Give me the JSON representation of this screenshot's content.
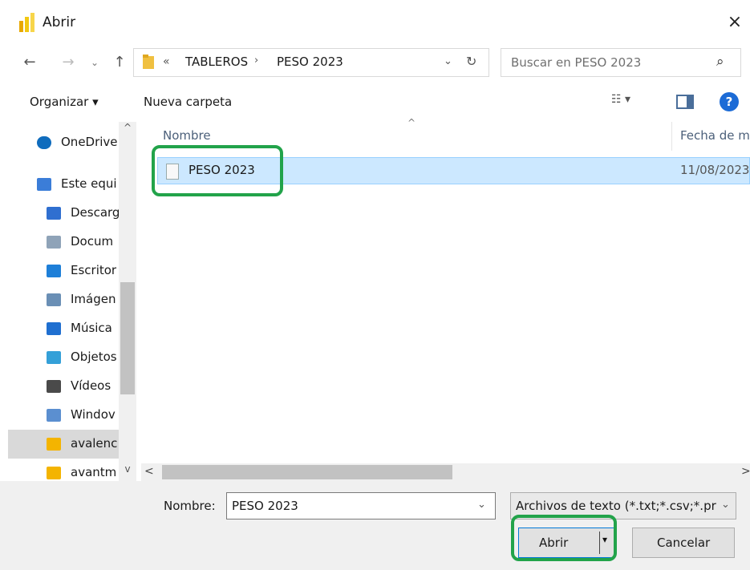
{
  "window": {
    "title": "Abrir",
    "close_icon": "×"
  },
  "navigation": {
    "back_icon": "←",
    "forward_icon": "→",
    "recent_icon": "⌄",
    "up_icon": "↑",
    "breadcrumb_overflow": "«",
    "path": [
      "TABLEROS",
      "PESO 2023"
    ],
    "path_separator": "›",
    "dropdown_icon": "⌄",
    "refresh_icon": "↻"
  },
  "search": {
    "placeholder": "Buscar en PESO 2023",
    "icon": "⌕"
  },
  "toolbar": {
    "organize_label": "Organizar ▾",
    "new_folder_label": "Nueva carpeta",
    "view_label": "☷ ▾",
    "help_label": "?"
  },
  "sidebar": {
    "items": [
      {
        "label": "OneDrive",
        "icon": "cloud-icon",
        "color": "#0f6cbd"
      },
      {
        "label": "Este equi",
        "icon": "computer-icon",
        "color": "#3b7dd8"
      },
      {
        "label": "Descarg",
        "icon": "download-icon",
        "color": "#2f6fd0"
      },
      {
        "label": "Docum",
        "icon": "document-icon",
        "color": "#8fa3b8"
      },
      {
        "label": "Escritor",
        "icon": "desktop-icon",
        "color": "#1e7fd8"
      },
      {
        "label": "Imágen",
        "icon": "image-icon",
        "color": "#6a8fb5"
      },
      {
        "label": "Música",
        "icon": "music-icon",
        "color": "#1f6fd0"
      },
      {
        "label": "Objetos",
        "icon": "3d-objects-icon",
        "color": "#34a0d8"
      },
      {
        "label": "Vídeos",
        "icon": "video-icon",
        "color": "#4a4a4a"
      },
      {
        "label": "Windov",
        "icon": "drive-icon",
        "color": "#5b8fd0"
      },
      {
        "label": "avalenc",
        "icon": "google-drive-icon",
        "color": "#f4b400"
      },
      {
        "label": "avantm",
        "icon": "google-drive-icon",
        "color": "#f4b400"
      }
    ],
    "selected_index": 10,
    "scroll_up_icon": "^",
    "scroll_down_icon": "v"
  },
  "file_list": {
    "columns": [
      "Nombre",
      "Fecha de m"
    ],
    "sort_icon": "^",
    "rows": [
      {
        "name": "PESO 2023",
        "date": "11/08/2023"
      }
    ]
  },
  "hscroll": {
    "left_icon": "<",
    "right_icon": ">"
  },
  "footer": {
    "filename_label": "Nombre:",
    "filename_value": "PESO 2023",
    "filename_dropdown": "⌄",
    "filter_value": "Archivos de texto (*.txt;*.csv;*.prn)",
    "filter_dropdown": "⌄",
    "open_label": "Abrir",
    "open_arrow": "▾",
    "cancel_label": "Cancelar"
  },
  "colors": {
    "highlight": "#22a34a",
    "selection": "#cce8ff",
    "accent": "#0078d7"
  }
}
